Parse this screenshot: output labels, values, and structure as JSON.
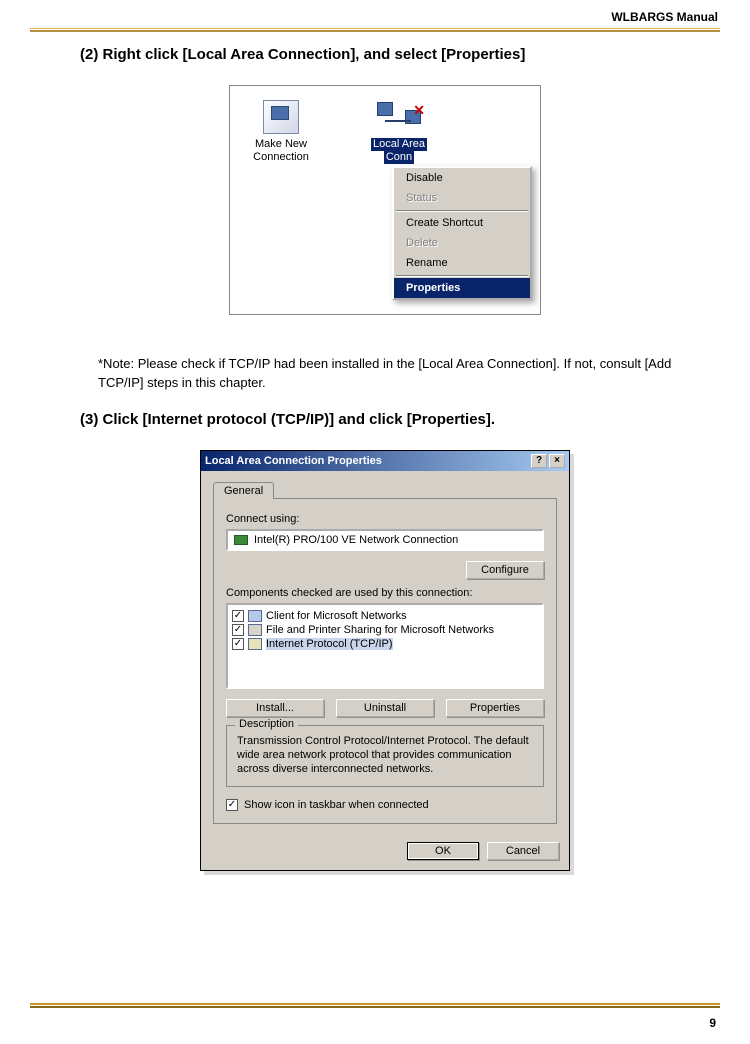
{
  "header": {
    "title": "WLBARGS Manual"
  },
  "step2": {
    "heading": "(2) Right click [Local Area Connection], and select [Properties]",
    "icons": {
      "makeNew_line1": "Make New",
      "makeNew_line2": "Connection",
      "lac_line1": "Local Area",
      "lac_line2": "Conn"
    },
    "menu": {
      "disable": "Disable",
      "status": "Status",
      "shortcut": "Create Shortcut",
      "delete": "Delete",
      "rename": "Rename",
      "properties": "Properties"
    }
  },
  "note": "*Note: Please check if TCP/IP had been installed in the [Local Area Connection]. If not, consult [Add TCP/IP] steps in this chapter.",
  "step3": {
    "heading": "(3) Click [Internet protocol (TCP/IP)] and click [Properties].",
    "dialog": {
      "title": "Local Area Connection Properties",
      "tab": "General",
      "connectUsing": "Connect using:",
      "adapter": "Intel(R) PRO/100 VE Network Connection",
      "configure": "Configure",
      "componentsLabel": "Components checked are used by this connection:",
      "items": {
        "client": "Client for Microsoft Networks",
        "fileprint": "File and Printer Sharing for Microsoft Networks",
        "tcpip": "Internet Protocol (TCP/IP)"
      },
      "install": "Install...",
      "uninstall": "Uninstall",
      "properties": "Properties",
      "descLabel": "Description",
      "descText": "Transmission Control Protocol/Internet Protocol. The default wide area network protocol that provides communication across diverse interconnected networks.",
      "showIcon": "Show icon in taskbar when connected",
      "ok": "OK",
      "cancel": "Cancel",
      "help": "?",
      "close": "×"
    }
  },
  "pageNumber": "9"
}
